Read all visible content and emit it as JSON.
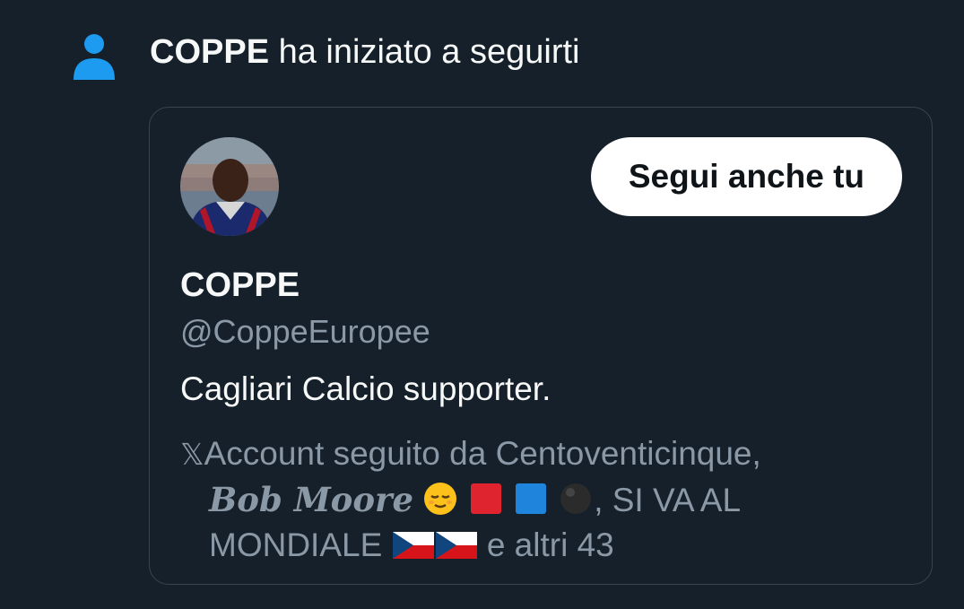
{
  "notification": {
    "actor_name": "COPPE",
    "action_text": "ha iniziato a seguirti",
    "icon": "person-icon",
    "icon_color": "#1d9bf0"
  },
  "profile_card": {
    "display_name": "COPPE",
    "handle": "@CoppeEuropee",
    "bio": "Cagliari Calcio supporter.",
    "follow_button_label": "Segui anche tu",
    "avatar": "profile-photo",
    "followed_by": {
      "x_glyph": "𝕏",
      "prefix": "Account seguito da Centoventicinque,",
      "name2": "Bob Moore",
      "name2_emojis": [
        "relieved-face-emoji",
        "red-square-emoji",
        "blue-square-emoji",
        "black-circle-emoji"
      ],
      "name3_part1": ", SI VA AL",
      "name3_part2": "MONDIALE",
      "name3_emojis": [
        "czech-flag-emoji",
        "czech-flag-emoji"
      ],
      "suffix": "e altri 43"
    }
  },
  "colors": {
    "background": "#15202b",
    "border": "#38444d",
    "secondary_text": "#8b98a5",
    "accent": "#1d9bf0",
    "button_bg": "#ffffff"
  }
}
